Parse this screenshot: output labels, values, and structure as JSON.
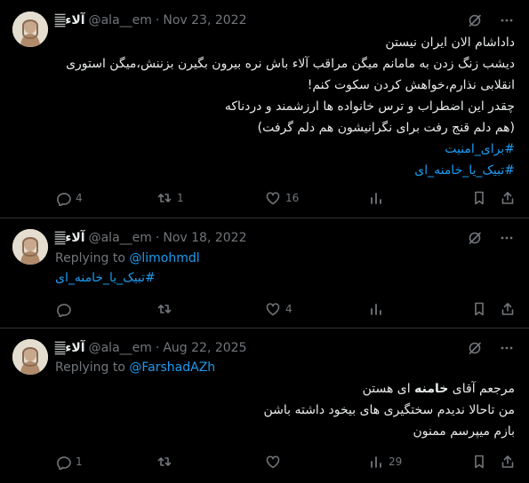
{
  "tweets": [
    {
      "author_name": "آلاء𝄛",
      "handle": "@ala__em",
      "separator": "·",
      "date": "Nov 23, 2022",
      "lines": [
        "داداشام الان ایران نیستن",
        "دیشب زنگ زدن به مامانم میگن مراقب آلاء باش نره بیرون بگیرن بزننش،میگن استوری",
        "انقلابی نذارم،خواهش کردن سکوت کنم!",
        "چقدر این اضطراب و ترس خانواده ها ارزشمند و دردناکه",
        "(هم دلم قنج رفت برای نگرانیشون هم دلم گرفت)"
      ],
      "hashtags": [
        "#برای_امنیت",
        "#تبیک_یا_خامنه_ای"
      ],
      "replies": "4",
      "retweets": "1",
      "likes": "16"
    },
    {
      "author_name": "آلاء𝄛",
      "handle": "@ala__em",
      "separator": "·",
      "date": "Nov 18, 2022",
      "replying_label": "Replying to",
      "replying_handle": "@limohmdl",
      "hashtag": "#تبیک_یا_خامنه_ای",
      "replies": "",
      "retweets": "",
      "likes": "4"
    },
    {
      "author_name": "آلاء𝄛",
      "handle": "@ala__em",
      "separator": "·",
      "date": "Aug 22, 2025",
      "replying_label": "Replying to",
      "replying_handle": "@FarshadAZh",
      "line1_pre": "مرجعم آقای ",
      "line1_bold": "خامنه",
      "line1_post": " ای هستن",
      "line2": "من تاحالا ندیدم سختگیری های بیخود داشته باشن",
      "line3": "بازم میپرسم ممنون",
      "replies": "1",
      "retweets": "",
      "likes": "29"
    }
  ],
  "icons": {
    "grok": "grok-icon",
    "more": "more-dots-icon",
    "reply": "reply-icon",
    "retweet": "retweet-icon",
    "like": "heart-icon",
    "views": "views-bar-icon",
    "bookmark": "bookmark-icon",
    "share": "share-icon"
  },
  "colors": {
    "background": "#000000",
    "text": "#e7e9ea",
    "muted": "#71767b",
    "link": "#1d9bf0",
    "divider": "#2f3336"
  }
}
